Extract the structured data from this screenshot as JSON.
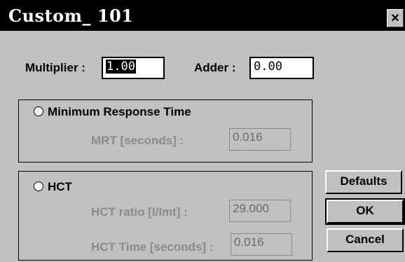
{
  "window": {
    "title": "Custom_ 101",
    "close_glyph": "×"
  },
  "multiplier": {
    "label": "Multiplier :",
    "value": "1.00"
  },
  "adder": {
    "label": "Adder :",
    "value": "0.00"
  },
  "mrt_group": {
    "radio_label": "Minimum Response Time",
    "field_label": "MRT [seconds] :",
    "value": "0.016"
  },
  "hct_group": {
    "radio_label": "HCT",
    "ratio_label": "HCT ratio [I/Imt] :",
    "ratio_value": "29.000",
    "time_label": "HCT Time [seconds] :",
    "time_value": "0.016"
  },
  "buttons": {
    "defaults": "Defaults",
    "ok": "OK",
    "cancel": "Cancel"
  }
}
